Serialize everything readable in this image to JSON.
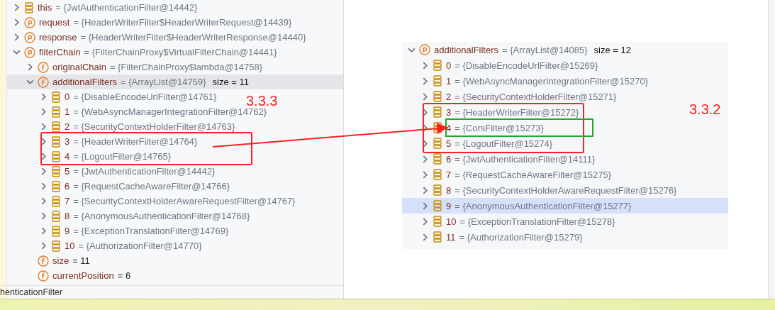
{
  "left_tree": [
    {
      "name": "this",
      "value": "= {JwtAuthenticationFilter@14442}",
      "kind": "element",
      "expanded": false,
      "selected": false
    },
    {
      "name": "request",
      "value": "= {HeaderWriterFilter$HeaderWriterRequest@14439}",
      "kind": "param",
      "expanded": false,
      "selected": false
    },
    {
      "name": "response",
      "value": "= {HeaderWriterFilter$HeaderWriterResponse@14440}",
      "kind": "param",
      "expanded": false,
      "selected": false
    },
    {
      "name": "filterChain",
      "value": "= {FilterChainProxy$VirtualFilterChain@14441}",
      "kind": "param",
      "expanded": true,
      "selected": false,
      "children": [
        {
          "name": "originalChain",
          "value": "= {FilterChainProxy$lambda@14758}",
          "kind": "field",
          "expanded": false,
          "selected": false
        },
        {
          "name": "additionalFilters",
          "value": "= {ArrayList@14759}",
          "extra": "size = 11",
          "kind": "field",
          "expanded": true,
          "selected": true,
          "children": [
            {
              "name": "0",
              "value": "= {DisableEncodeUrlFilter@14761}",
              "kind": "element",
              "expanded": false,
              "selected": false
            },
            {
              "name": "1",
              "value": "= {WebAsyncManagerIntegrationFilter@14762}",
              "kind": "element",
              "expanded": false,
              "selected": false
            },
            {
              "name": "2",
              "value": "= {SecurityContextHolderFilter@14763}",
              "kind": "element",
              "expanded": false,
              "selected": false
            },
            {
              "name": "3",
              "value": "= {HeaderWriterFilter@14764}",
              "kind": "element",
              "expanded": false,
              "selected": false
            },
            {
              "name": "4",
              "value": "= {LogoutFilter@14765}",
              "kind": "element",
              "expanded": false,
              "selected": false
            },
            {
              "name": "5",
              "value": "= {JwtAuthenticationFilter@14442}",
              "kind": "element",
              "expanded": false,
              "selected": false
            },
            {
              "name": "6",
              "value": "= {RequestCacheAwareFilter@14766}",
              "kind": "element",
              "expanded": false,
              "selected": false
            },
            {
              "name": "7",
              "value": "= {SecurityContextHolderAwareRequestFilter@14767}",
              "kind": "element",
              "expanded": false,
              "selected": false
            },
            {
              "name": "8",
              "value": "= {AnonymousAuthenticationFilter@14768}",
              "kind": "element",
              "expanded": false,
              "selected": false
            },
            {
              "name": "9",
              "value": "= {ExceptionTranslationFilter@14769}",
              "kind": "element",
              "expanded": false,
              "selected": false
            },
            {
              "name": "10",
              "value": "= {AuthorizationFilter@14770}",
              "kind": "element",
              "expanded": false,
              "selected": false
            }
          ]
        },
        {
          "name": "size",
          "value": "= 11",
          "kind": "field_value",
          "selected": false
        },
        {
          "name": "currentPosition",
          "value": "= 6",
          "kind": "field_value",
          "selected": false
        }
      ]
    }
  ],
  "status_text": "henticationFilter",
  "right_tree": [
    {
      "name": "additionalFilters",
      "value": "= {ArrayList@14085}",
      "extra": "size = 12",
      "kind": "param",
      "expanded": true,
      "selected": false,
      "children": [
        {
          "name": "0",
          "value": "= {DisableEncodeUrlFilter@15269}",
          "kind": "element",
          "expanded": false,
          "selected": false
        },
        {
          "name": "1",
          "value": "= {WebAsyncManagerIntegrationFilter@15270}",
          "kind": "element",
          "expanded": false,
          "selected": false
        },
        {
          "name": "2",
          "value": "= {SecurityContextHolderFilter@15271}",
          "kind": "element",
          "expanded": false,
          "selected": false
        },
        {
          "name": "3",
          "value": "= {HeaderWriterFilter@15272}",
          "kind": "element",
          "expanded": false,
          "selected": false
        },
        {
          "name": "4",
          "value": "= {CorsFilter@15273}",
          "kind": "element",
          "expanded": false,
          "selected": false
        },
        {
          "name": "5",
          "value": "= {LogoutFilter@15274}",
          "kind": "element",
          "expanded": false,
          "selected": false
        },
        {
          "name": "6",
          "value": "= {JwtAuthenticationFilter@14111}",
          "kind": "element",
          "expanded": false,
          "selected": false
        },
        {
          "name": "7",
          "value": "= {RequestCacheAwareFilter@15275}",
          "kind": "element",
          "expanded": false,
          "selected": false
        },
        {
          "name": "8",
          "value": "= {SecurityContextHolderAwareRequestFilter@15276}",
          "kind": "element",
          "expanded": false,
          "selected": false
        },
        {
          "name": "9",
          "value": "= {AnonymousAuthenticationFilter@15277}",
          "kind": "element",
          "expanded": false,
          "selected": true
        },
        {
          "name": "10",
          "value": "= {ExceptionTranslationFilter@15278}",
          "kind": "element",
          "expanded": false,
          "selected": false
        },
        {
          "name": "11",
          "value": "= {AuthorizationFilter@15279}",
          "kind": "element",
          "expanded": false,
          "selected": false
        }
      ]
    }
  ],
  "annotations": [
    {
      "kind": "label",
      "text": "3.3.3"
    },
    {
      "kind": "label",
      "text": "3.3.2"
    }
  ]
}
